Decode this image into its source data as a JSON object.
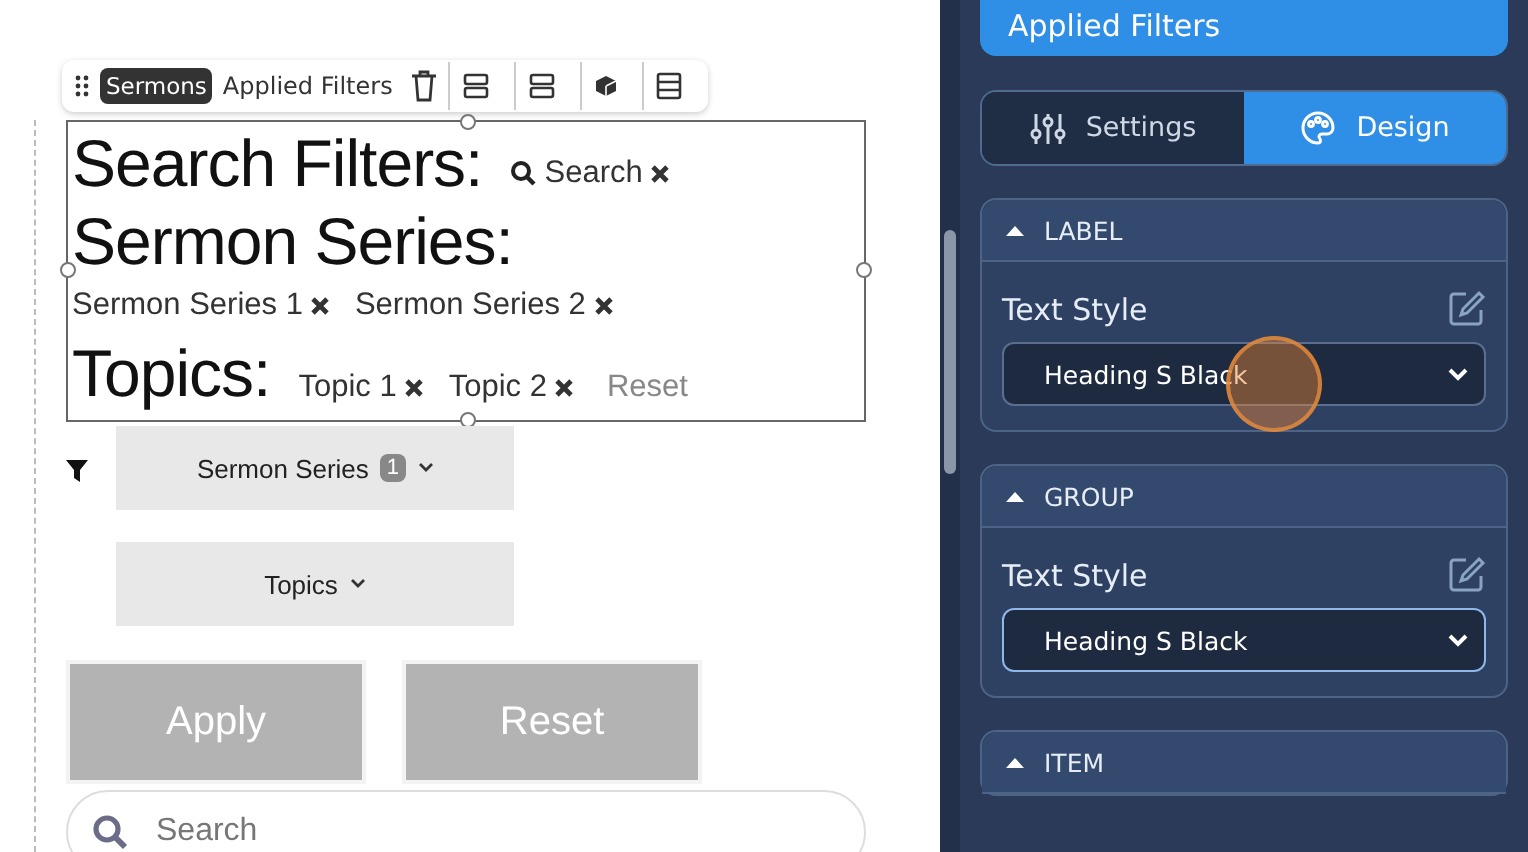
{
  "toolbar": {
    "badge": "Sermons",
    "title": "Applied Filters"
  },
  "applied": {
    "rows": [
      {
        "kind": "inline",
        "heading": "Search Filters:",
        "chips": [
          {
            "label": "Search"
          }
        ]
      },
      {
        "kind": "block",
        "heading": "Sermon Series:",
        "chips": [
          {
            "label": "Sermon Series 1"
          },
          {
            "label": "Sermon Series 2"
          }
        ]
      },
      {
        "kind": "inline",
        "heading": "Topics:",
        "chips": [
          {
            "label": "Topic 1"
          },
          {
            "label": "Topic 2"
          }
        ],
        "reset": "Reset"
      }
    ]
  },
  "dropdowns": [
    {
      "label": "Sermon Series",
      "count": "1"
    },
    {
      "label": "Topics"
    }
  ],
  "buttons": [
    "Apply",
    "Reset"
  ],
  "search": {
    "placeholder": "Search"
  },
  "panel": {
    "title": "Applied Filters",
    "tabs": [
      {
        "label": "Settings",
        "selected": false
      },
      {
        "label": "Design",
        "selected": true
      }
    ],
    "sections": [
      {
        "title": "LABEL",
        "expanded": true,
        "field": "Text Style",
        "value": "Heading S Black",
        "focused": false
      },
      {
        "title": "GROUP",
        "expanded": true,
        "field": "Text Style",
        "value": "Heading S Black",
        "focused": true
      },
      {
        "title": "ITEM",
        "expanded": true
      }
    ]
  }
}
